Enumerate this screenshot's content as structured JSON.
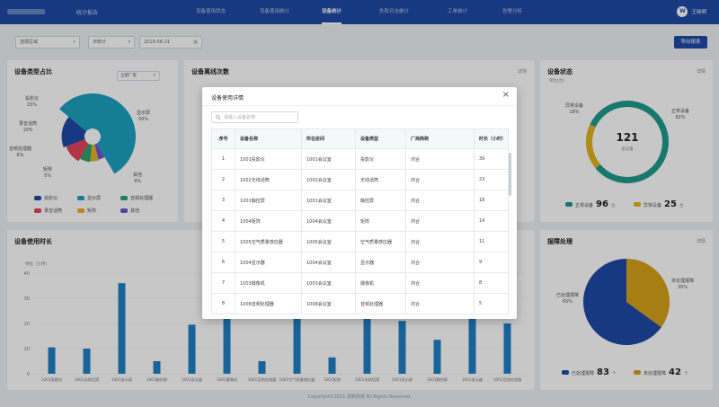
{
  "header": {
    "app_title": "统计报告",
    "nav": [
      {
        "label": "设备使用状态",
        "active": false
      },
      {
        "label": "设备使用统计",
        "active": false
      },
      {
        "label": "设备统计",
        "active": true
      },
      {
        "label": "失败日志统计",
        "active": false
      },
      {
        "label": "工单统计",
        "active": false
      },
      {
        "label": "告警分析",
        "active": false
      }
    ],
    "avatar_letter": "W",
    "username": "王晓明"
  },
  "filters": {
    "region": "选择区域",
    "period": "日统计",
    "date": "2019-06-21",
    "export_label": "导出报表"
  },
  "type_ratio": {
    "title": "设备类型占比",
    "vendor_select": "全部厂家",
    "labels": [
      {
        "text": "投影仪",
        "pct": "15%"
      },
      {
        "text": "显示屏",
        "pct": "50%"
      },
      {
        "text": "录音话筒",
        "pct": "10%"
      },
      {
        "text": "音频处理器",
        "pct": "6%"
      },
      {
        "text": "矩阵",
        "pct": "5%"
      },
      {
        "text": "其他",
        "pct": "4%"
      }
    ],
    "legend": [
      "投影仪",
      "显示屏",
      "音频处理器",
      "录音话筒",
      "矩阵",
      "其他"
    ]
  },
  "offline_count": {
    "title": "设备离线次数",
    "more": "详情"
  },
  "device_status": {
    "title": "设备状态",
    "subtitle": "单位(台)",
    "more": "详情",
    "total": "121",
    "total_label": "总设备",
    "normal": {
      "label": "正常设备",
      "pct": "82%",
      "count": "96",
      "unit": "台"
    },
    "abnormal": {
      "label": "异常设备",
      "pct": "18%",
      "count": "25",
      "unit": "台"
    }
  },
  "usage_time": {
    "title": "设备使用时长",
    "unit_label": "单位（小时）"
  },
  "fault": {
    "title": "报障处理",
    "more": "详情",
    "done": {
      "label": "已处理报障",
      "pct": "65%",
      "count": "83",
      "unit": "个"
    },
    "todo": {
      "label": "未处理报障",
      "pct": "35%",
      "count": "42",
      "unit": "个"
    }
  },
  "footer": "Copyright©2021 润帆科技 All Rights Reserved.",
  "modal": {
    "title": "设备使用详情",
    "search_placeholder": "请输入设备名称",
    "columns": [
      "序号",
      "设备名称",
      "所在房间",
      "设备类型",
      "厂商简称",
      "时长（小时）"
    ],
    "rows": [
      [
        "1",
        "1001投影仪",
        "1001会议室",
        "投影仪",
        "鸿合",
        "39"
      ],
      [
        "2",
        "1002无线话筒",
        "1002会议室",
        "无线话筒",
        "鸿合",
        "23"
      ],
      [
        "3",
        "1001触控屏",
        "1001会议室",
        "触控屏",
        "鸿合",
        "18"
      ],
      [
        "4",
        "1004矩阵",
        "1004会议室",
        "矩阵",
        "鸿合",
        "14"
      ],
      [
        "5",
        "1005空气质量感应器",
        "1005会议室",
        "空气质量感应器",
        "鸿合",
        "11"
      ],
      [
        "6",
        "1004显示器",
        "1004会议室",
        "显示器",
        "鸿合",
        "9"
      ],
      [
        "7",
        "1003摄像机",
        "1003会议室",
        "摄像机",
        "鸿合",
        "8"
      ],
      [
        "8",
        "1008音频处理器",
        "1008会议室",
        "音频处理器",
        "鸿合",
        "5"
      ]
    ]
  },
  "chart_data": [
    {
      "type": "pie",
      "title": "设备类型占比",
      "slices": [
        {
          "name": "投影仪",
          "value": 15,
          "color": "#1f4aa6"
        },
        {
          "name": "显示屏",
          "value": 50,
          "color": "#1e9fc0"
        },
        {
          "name": "音频处理器",
          "value": 6,
          "color": "#2aa36b"
        },
        {
          "name": "录音话筒",
          "value": 10,
          "color": "#e0455c"
        },
        {
          "name": "矩阵",
          "value": 5,
          "color": "#e7b12a"
        },
        {
          "name": "其他",
          "value": 4,
          "color": "#6b57c9"
        }
      ]
    },
    {
      "type": "pie",
      "title": "设备状态",
      "slices": [
        {
          "name": "正常设备",
          "value": 82,
          "color": "#1f9a8a"
        },
        {
          "name": "异常设备",
          "value": 18,
          "color": "#e2b31f"
        }
      ]
    },
    {
      "type": "pie",
      "title": "报障处理",
      "slices": [
        {
          "name": "已处理报障",
          "value": 65,
          "color": "#1f4aa6"
        },
        {
          "name": "未处理报障",
          "value": 35,
          "color": "#d6a21a"
        }
      ]
    },
    {
      "type": "bar",
      "title": "设备使用时长",
      "ylabel": "单位（小时）",
      "ylim": [
        0,
        40
      ],
      "yticks": [
        0,
        10,
        20,
        30,
        40
      ],
      "color": "#1f7fc4",
      "categories": [
        "1001投影机",
        "1001无线话筒",
        "1001显示屏",
        "1001触控屏",
        "1001显示器",
        "1001摄像机",
        "1001音频处理器",
        "1001空气质量感应器",
        "1001矩阵",
        "1001无线话筒",
        "1001显示屏",
        "1001触控屏",
        "1001显示器",
        "1001音频处理器"
      ],
      "values": [
        10.5,
        10,
        36,
        5,
        19.5,
        26,
        5,
        26,
        6.5,
        26,
        21,
        13.5,
        26,
        20
      ]
    }
  ]
}
